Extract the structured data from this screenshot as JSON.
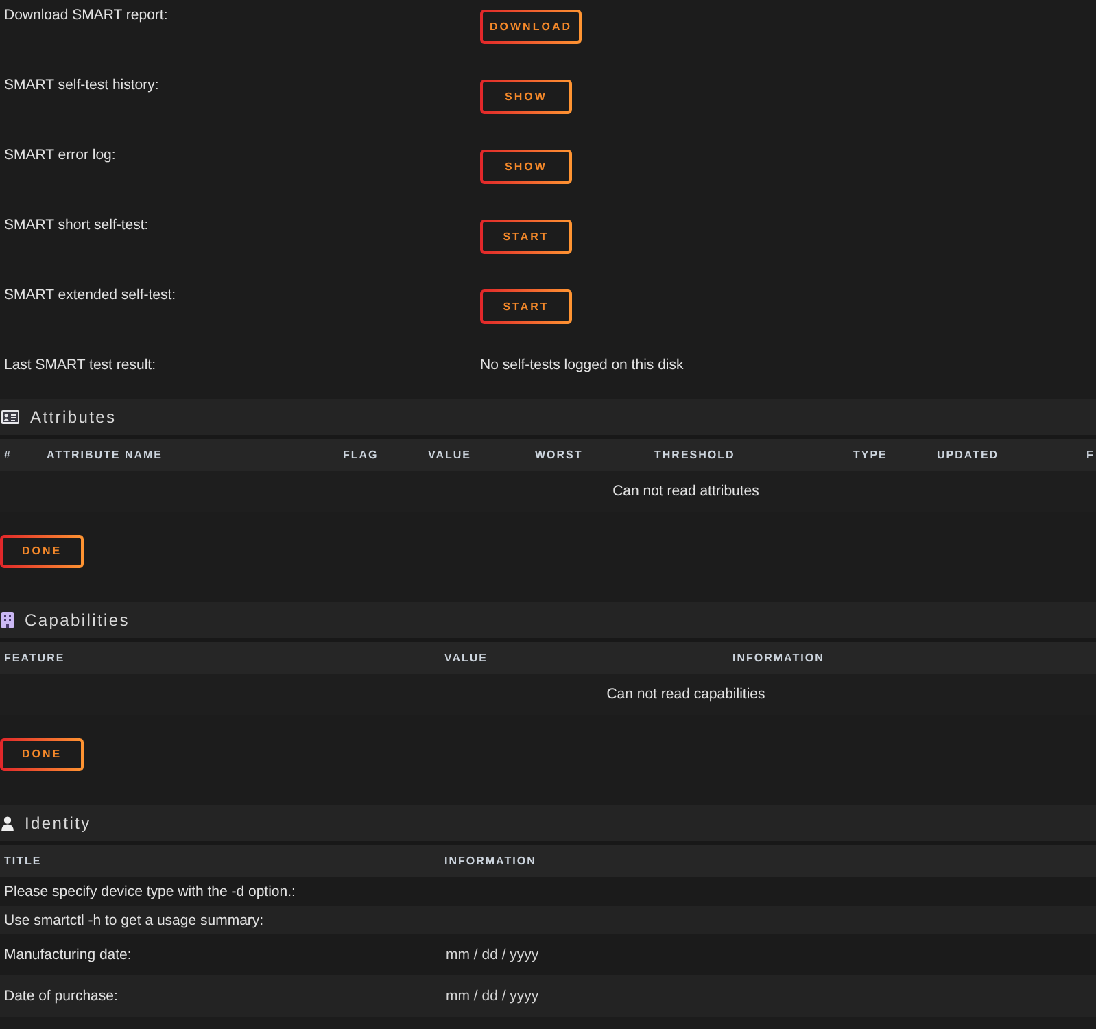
{
  "smart": {
    "rows": [
      {
        "kind": "button",
        "label": "Download SMART report:",
        "button": "DOWNLOAD"
      },
      {
        "kind": "button",
        "label": "SMART self-test history:",
        "button": "SHOW"
      },
      {
        "kind": "button",
        "label": "SMART error log:",
        "button": "SHOW"
      },
      {
        "kind": "button",
        "label": "SMART short self-test:",
        "button": "START"
      },
      {
        "kind": "button",
        "label": "SMART extended self-test:",
        "button": "START"
      },
      {
        "kind": "text",
        "label": "Last SMART test result:",
        "value": "No self-tests logged on this disk"
      }
    ]
  },
  "attributes": {
    "title": "Attributes",
    "columns": [
      "#",
      "ATTRIBUTE NAME",
      "FLAG",
      "VALUE",
      "WORST",
      "THRESHOLD",
      "TYPE",
      "UPDATED",
      "F"
    ],
    "empty_message": "Can not read attributes",
    "done_button": "DONE"
  },
  "capabilities": {
    "title": "Capabilities",
    "columns": [
      "FEATURE",
      "VALUE",
      "INFORMATION"
    ],
    "empty_message": "Can not read capabilities",
    "done_button": "DONE"
  },
  "identity": {
    "title": "Identity",
    "columns": [
      "TITLE",
      "INFORMATION"
    ],
    "rows": [
      {
        "kind": "text",
        "title": "Please specify device type with the -d option.:"
      },
      {
        "kind": "text",
        "title": "Use smartctl -h to get a usage summary:"
      },
      {
        "kind": "date",
        "title": "Manufacturing date:",
        "date_field": {
          "placeholder": "mm / dd / yyyy"
        }
      },
      {
        "kind": "date",
        "title": "Date of purchase:",
        "date_field": {
          "placeholder": "mm / dd / yyyy"
        }
      }
    ]
  }
}
